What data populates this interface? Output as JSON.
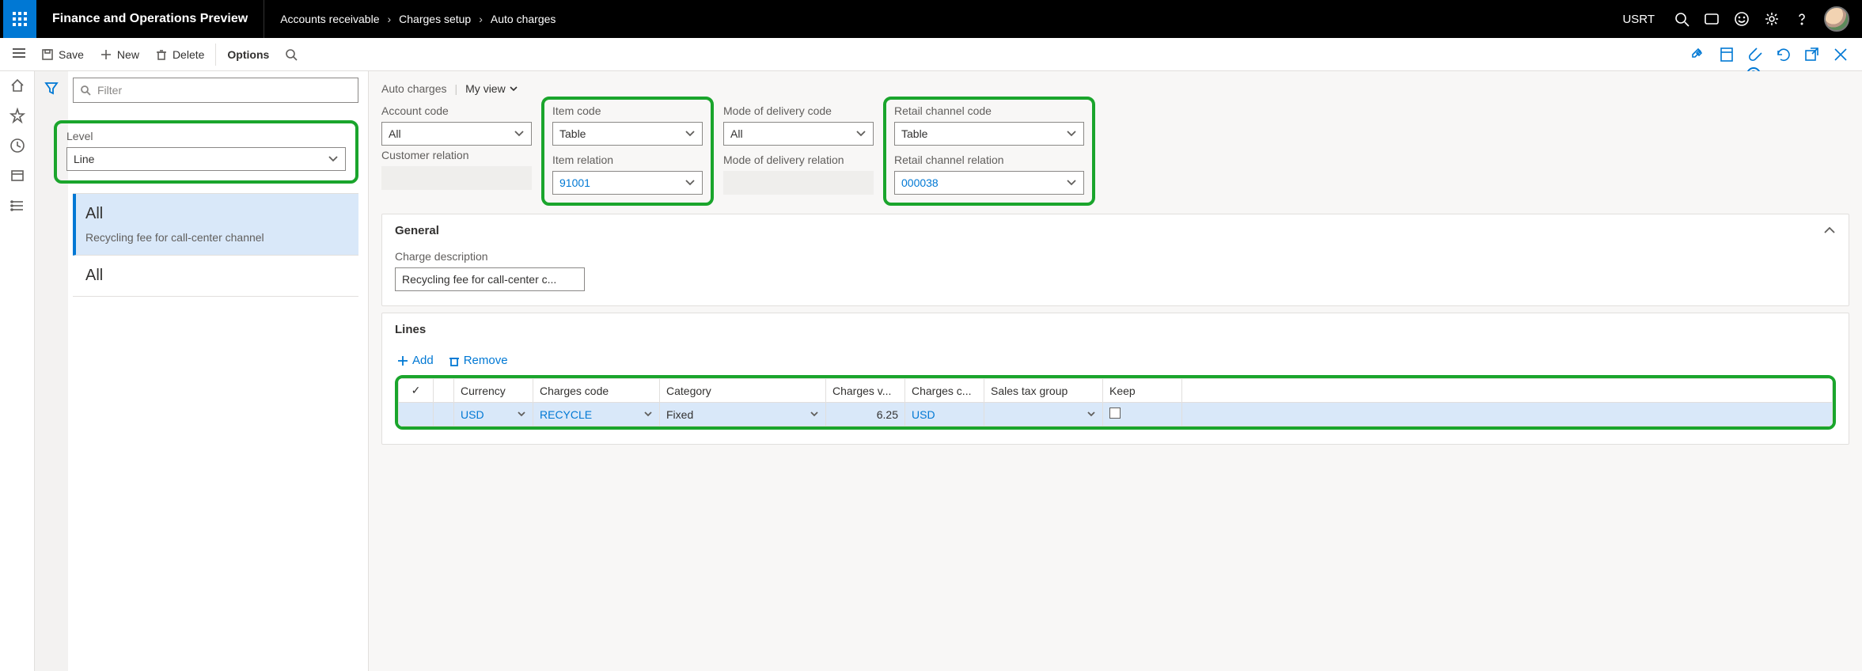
{
  "top": {
    "app_title": "Finance and Operations Preview",
    "company": "USRT",
    "breadcrumb": [
      "Accounts receivable",
      "Charges setup",
      "Auto charges"
    ]
  },
  "actions": {
    "save": "Save",
    "new": "New",
    "delete": "Delete",
    "options": "Options",
    "attach_count": "0"
  },
  "filter": {
    "placeholder": "Filter"
  },
  "level": {
    "label": "Level",
    "value": "Line"
  },
  "list": {
    "items": [
      {
        "title": "All",
        "sub": "Recycling fee for call-center channel",
        "selected": true
      },
      {
        "title": "All",
        "sub": "",
        "selected": false
      }
    ]
  },
  "page": {
    "title": "Auto charges",
    "view_label": "My view"
  },
  "codes": {
    "account": {
      "label": "Account code",
      "value": "All"
    },
    "item": {
      "label": "Item code",
      "value": "Table"
    },
    "delivery": {
      "label": "Mode of delivery code",
      "value": "All"
    },
    "channel": {
      "label": "Retail channel code",
      "value": "Table"
    }
  },
  "relations": {
    "customer": {
      "label": "Customer relation",
      "value": ""
    },
    "item": {
      "label": "Item relation",
      "value": "91001"
    },
    "delivery": {
      "label": "Mode of delivery relation",
      "value": ""
    },
    "channel": {
      "label": "Retail channel relation",
      "value": "000038"
    }
  },
  "general": {
    "title": "General",
    "desc_label": "Charge description",
    "desc_value": "Recycling fee for call-center c..."
  },
  "lines": {
    "title": "Lines",
    "add": "Add",
    "remove": "Remove",
    "columns": [
      "Currency",
      "Charges code",
      "Category",
      "Charges v...",
      "Charges c...",
      "Sales tax group",
      "Keep",
      ""
    ],
    "rows": [
      {
        "currency": "USD",
        "code": "RECYCLE",
        "category": "Fixed",
        "value": "6.25",
        "ccur": "USD",
        "tax": "",
        "keep": false
      }
    ]
  }
}
